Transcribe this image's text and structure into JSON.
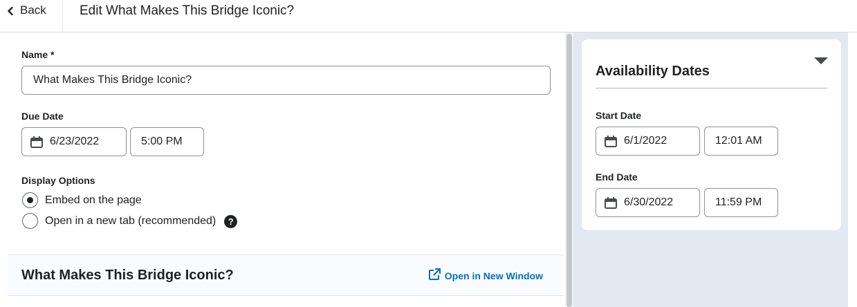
{
  "header": {
    "back_label": "Back",
    "title": "Edit What Makes This Bridge Iconic?"
  },
  "form": {
    "name_label": "Name *",
    "name_value": "What Makes This Bridge Iconic?",
    "due_date_label": "Due Date",
    "due_date": "6/23/2022",
    "due_time": "5:00 PM",
    "display_options_label": "Display Options",
    "display_options": [
      {
        "label": "Embed on the page",
        "selected": true
      },
      {
        "label": "Open in a new tab (recommended)",
        "selected": false
      }
    ]
  },
  "preview": {
    "title": "What Makes This Bridge Iconic?",
    "open_window_label": "Open in New Window"
  },
  "availability": {
    "title": "Availability Dates",
    "start_label": "Start Date",
    "start_date": "6/1/2022",
    "start_time": "12:01 AM",
    "end_label": "End Date",
    "end_date": "6/30/2022",
    "end_time": "11:59 PM"
  },
  "icons": {
    "back": "chevron-left-icon",
    "calendar": "calendar-icon",
    "help": "help-icon",
    "external_link": "external-link-icon",
    "collapse": "caret-down-icon"
  },
  "colors": {
    "link": "#006fbf",
    "side_panel_bg": "#e3e9f1",
    "text": "#202122"
  }
}
